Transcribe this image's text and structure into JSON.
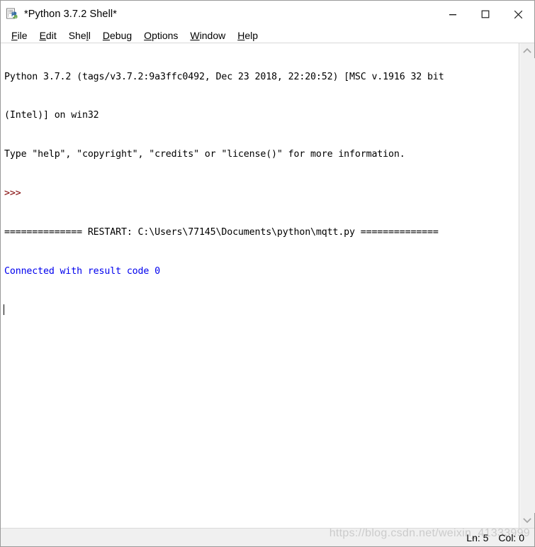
{
  "window": {
    "title": "*Python 3.7.2 Shell*",
    "icon": "python-idle-icon",
    "controls": {
      "minimize": "minimize-icon",
      "maximize": "maximize-icon",
      "close": "close-icon"
    }
  },
  "menubar": {
    "items": [
      {
        "label": "File",
        "mnemonic": "F",
        "pre": "",
        "post": "ile"
      },
      {
        "label": "Edit",
        "mnemonic": "E",
        "pre": "",
        "post": "dit"
      },
      {
        "label": "Shell",
        "mnemonic": "l",
        "pre": "She",
        "post": "l"
      },
      {
        "label": "Debug",
        "mnemonic": "D",
        "pre": "",
        "post": "ebug"
      },
      {
        "label": "Options",
        "mnemonic": "O",
        "pre": "",
        "post": "ptions"
      },
      {
        "label": "Window",
        "mnemonic": "W",
        "pre": "",
        "post": "indow"
      },
      {
        "label": "Help",
        "mnemonic": "H",
        "pre": "",
        "post": "elp"
      }
    ]
  },
  "console": {
    "lines": [
      {
        "text": "Python 3.7.2 (tags/v3.7.2:9a3ffc0492, Dec 23 2018, 22:20:52) [MSC v.1916 32 bit",
        "color": "black"
      },
      {
        "text": "(Intel)] on win32",
        "color": "black"
      },
      {
        "text": "Type \"help\", \"copyright\", \"credits\" or \"license()\" for more information.",
        "color": "black"
      },
      {
        "text": ">>> ",
        "color": "prompt"
      },
      {
        "text": "============== RESTART: C:\\Users\\77145\\Documents\\python\\mqtt.py ==============",
        "color": "black"
      },
      {
        "text": "Connected with result code 0",
        "color": "blue"
      },
      {
        "text": "",
        "color": "black",
        "caret": true
      }
    ]
  },
  "scrollbar": {
    "up_arrow": "chevron-up-icon",
    "down_arrow": "chevron-down-icon"
  },
  "statusbar": {
    "line_label": "Ln: 5",
    "col_label": "Col: 0"
  },
  "watermark": {
    "text": "https://blog.csdn.net/weixin_41333999"
  },
  "colors": {
    "prompt_red": "#7f0000",
    "output_blue": "#0000ee",
    "text_black": "#000000",
    "chrome_gray": "#f0f0f0",
    "border_gray": "#9a9a9a"
  }
}
